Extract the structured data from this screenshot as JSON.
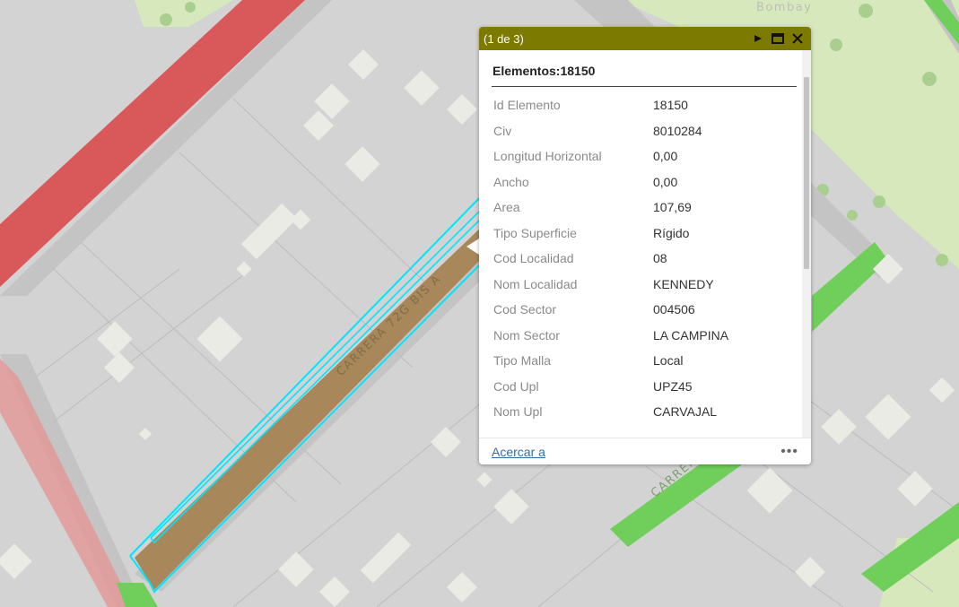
{
  "map": {
    "street_labels": [
      "CARRERA 72G BIS A",
      "CARRERA"
    ],
    "place_label": "Bombay",
    "colors": {
      "block_bg": "#d3d3d3",
      "road_grey": "#c4c4c4",
      "building": "#ebebe5",
      "park": "#d8e8bd",
      "selected_road": "#a8875a",
      "selection_outline": "#00e5ff",
      "road_red": "#d9585a",
      "road_green": "#6fcf5a"
    }
  },
  "popup": {
    "counter": "(1 de 3)",
    "title": "Elementos:18150",
    "header_color": "#7c7a00",
    "fields": [
      {
        "name": "Id Elemento",
        "value": "18150"
      },
      {
        "name": "Civ",
        "value": "8010284"
      },
      {
        "name": "Longitud Horizontal",
        "value": "0,00"
      },
      {
        "name": "Ancho",
        "value": "0,00"
      },
      {
        "name": "Area",
        "value": "107,69"
      },
      {
        "name": "Tipo Superficie",
        "value": "Rígido"
      },
      {
        "name": "Cod Localidad",
        "value": "08"
      },
      {
        "name": "Nom Localidad",
        "value": "KENNEDY"
      },
      {
        "name": "Cod Sector",
        "value": "004506"
      },
      {
        "name": "Nom Sector",
        "value": "LA CAMPINA"
      },
      {
        "name": "Tipo Malla",
        "value": "Local"
      },
      {
        "name": "Cod Upl",
        "value": "UPZ45"
      },
      {
        "name": "Nom Upl",
        "value": "CARVAJAL"
      }
    ],
    "footer": {
      "zoom_label": "Acercar a",
      "more_label": "•••"
    },
    "icons": {
      "next": "play-triangle-icon",
      "maximize": "maximize-icon",
      "close": "close-icon",
      "more": "more-dots-icon"
    }
  }
}
